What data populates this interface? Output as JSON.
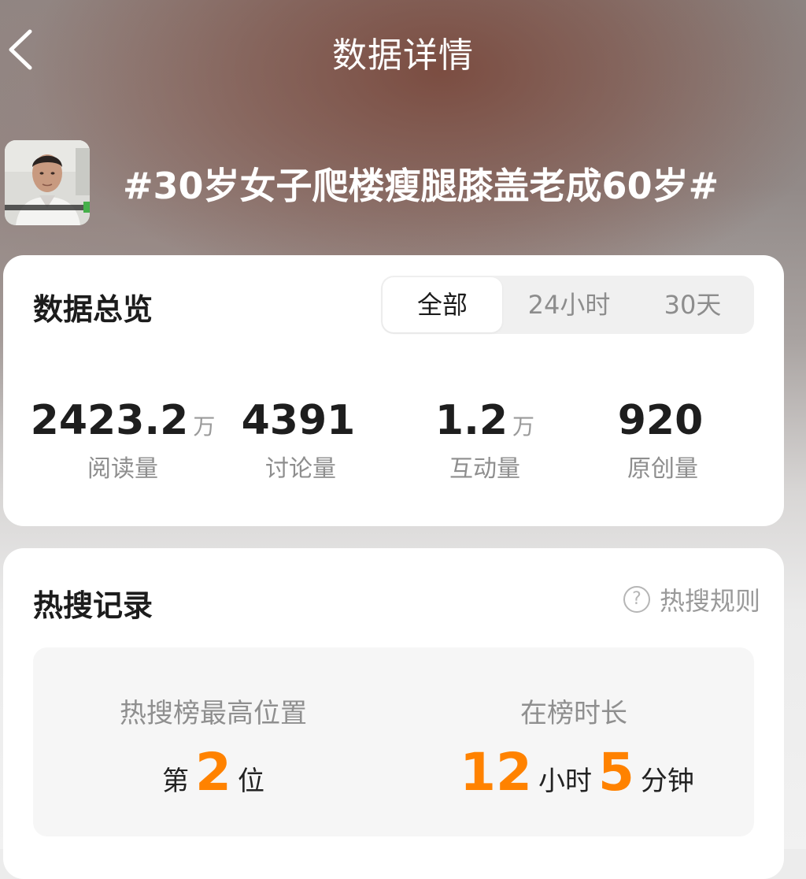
{
  "header": {
    "title": "数据详情",
    "back_icon": "chevron-left-icon"
  },
  "topic": {
    "title": "#30岁女子爬楼瘦腿膝盖老成60岁#",
    "thumbnail": "video-thumbnail"
  },
  "overview": {
    "title": "数据总览",
    "tabs": [
      "全部",
      "24小时",
      "30天"
    ],
    "selected_tab": "全部",
    "stats": [
      {
        "value": "2423.2",
        "unit": "万",
        "label": "阅读量"
      },
      {
        "value": "4391",
        "unit": "",
        "label": "讨论量"
      },
      {
        "value": "1.2",
        "unit": "万",
        "label": "互动量"
      },
      {
        "value": "920",
        "unit": "",
        "label": "原创量"
      }
    ]
  },
  "hot_search": {
    "title": "热搜记录",
    "rules_label": "热搜规则",
    "rules_icon": "question-circle-icon",
    "peak": {
      "label": "热搜榜最高位置",
      "prefix": "第",
      "value": "2",
      "suffix": "位"
    },
    "duration": {
      "label": "在榜时长",
      "hours": "12",
      "hours_unit": "小时",
      "minutes": "5",
      "minutes_unit": "分钟"
    }
  },
  "colors": {
    "accent": "#ff8200",
    "text_primary": "#1c1c1c",
    "text_secondary": "#8e8e8e"
  }
}
